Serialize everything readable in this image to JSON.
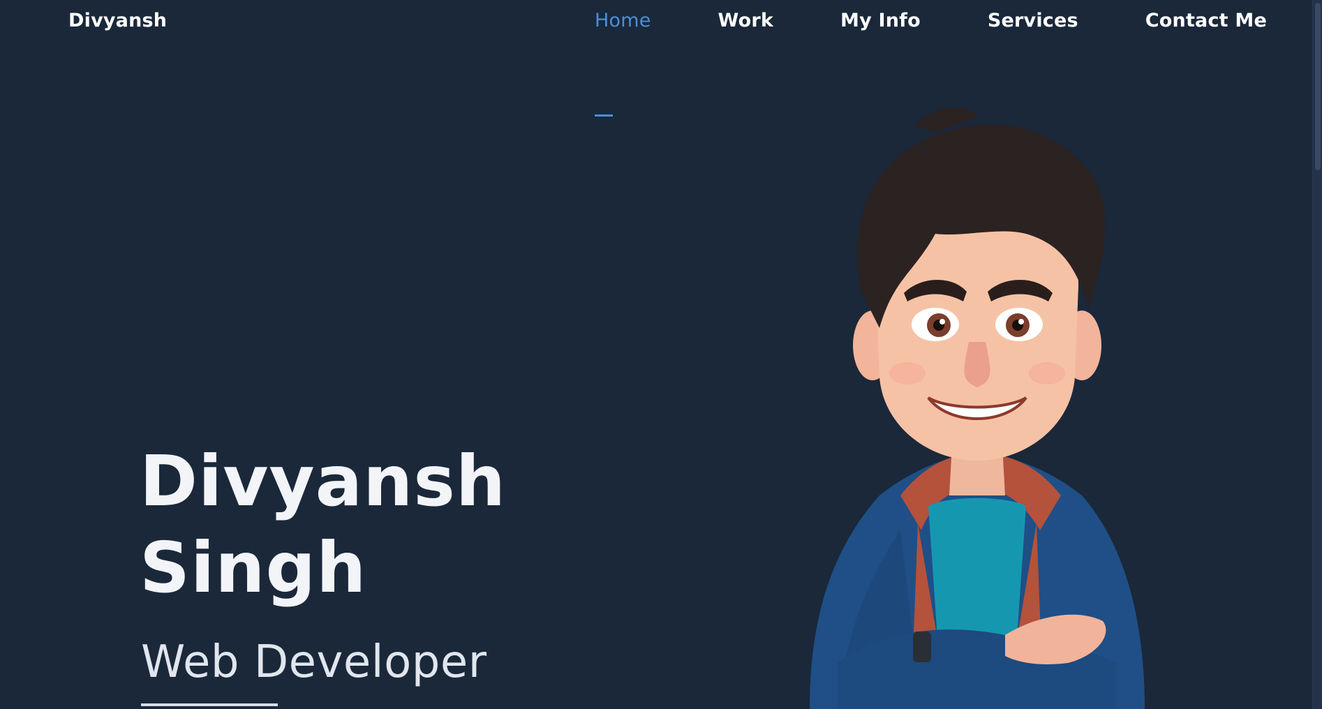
{
  "header": {
    "brand": "Divyansh",
    "nav": [
      {
        "label": "Home",
        "active": true
      },
      {
        "label": "Work",
        "active": false
      },
      {
        "label": "My Info",
        "active": false
      },
      {
        "label": "Services",
        "active": false
      },
      {
        "label": "Contact Me",
        "active": false
      }
    ]
  },
  "hero": {
    "first_name": "Divyansh",
    "last_name": "Singh",
    "role": "Web Developer"
  },
  "colors": {
    "background": "#1a283a",
    "accent": "#4b8fd8",
    "text": "#ffffff"
  },
  "icons": {
    "avatar": "cartoon-avatar-illustration"
  }
}
